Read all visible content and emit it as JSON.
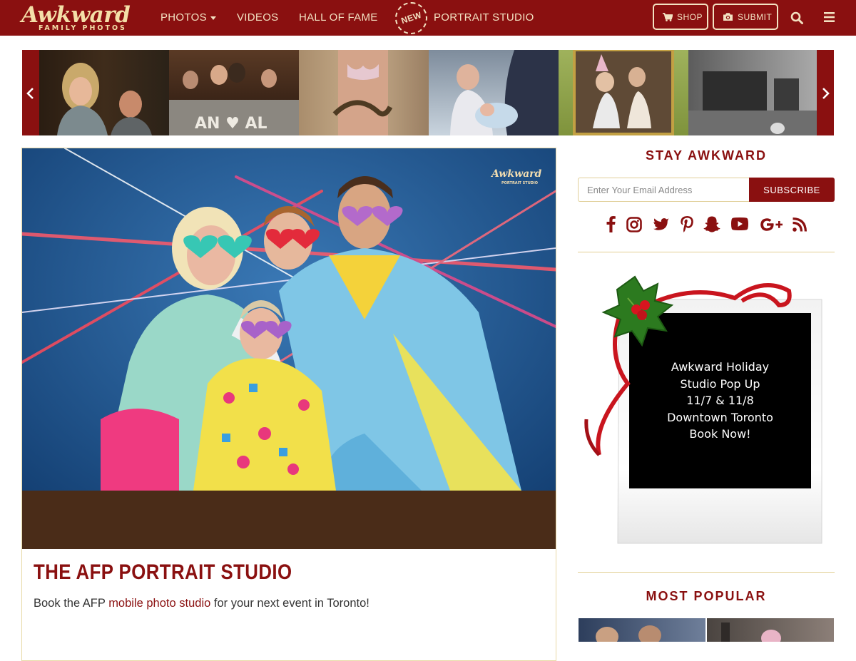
{
  "header": {
    "logo_word": "Awkward",
    "logo_sub": "FAMILY PHOTOS",
    "nav": {
      "photos": "PHOTOS",
      "videos": "VIDEOS",
      "hall_of_fame": "HALL OF FAME",
      "new_badge": "NEW",
      "portrait_studio": "PORTRAIT STUDIO"
    },
    "shop_label": "SHOP",
    "submit_label": "SUBMIT"
  },
  "carousel": {
    "photos": [
      "couple-portrait-photo",
      "wedding-cake-photo",
      "snake-costume-photo",
      "newborn-baby-photo",
      "party-hats-photo",
      "living-room-photo"
    ]
  },
  "feature": {
    "title": "THE AFP PORTRAIT STUDIO",
    "desc_before": "Book the AFP ",
    "desc_link": "mobile photo studio",
    "desc_after": " for your next event in Toronto!",
    "photo_logo_word": "Awkward",
    "photo_logo_sub": "PORTRAIT STUDIO"
  },
  "sidebar": {
    "stay_heading": "STAY AWKWARD",
    "email_placeholder": "Enter Your Email Address",
    "subscribe_label": "SUBSCRIBE",
    "socials": [
      "facebook-icon",
      "instagram-icon",
      "twitter-icon",
      "pinterest-icon",
      "snapchat-icon",
      "youtube-icon",
      "google-plus-icon",
      "rss-icon"
    ],
    "promo_lines": [
      "Awkward Holiday",
      "Studio Pop Up",
      "11/7 & 11/8",
      "Downtown Toronto",
      "Book Now!"
    ],
    "popular_heading": "MOST POPULAR"
  },
  "colors": {
    "brand": "#8a1010",
    "cream": "#f4dfa8",
    "rule": "#e2cf93"
  }
}
